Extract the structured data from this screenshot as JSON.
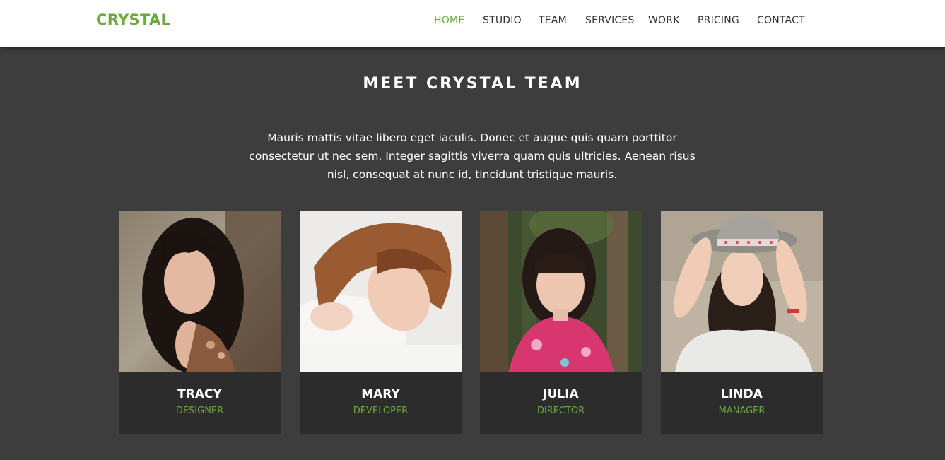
{
  "brand": {
    "name": "CRYSTAL"
  },
  "nav": {
    "items": [
      {
        "label": "HOME",
        "active": true
      },
      {
        "label": "STUDIO",
        "active": false
      },
      {
        "label": "TEAM",
        "active": false
      },
      {
        "label": "SERVICES",
        "active": false
      },
      {
        "label": "WORK",
        "active": false
      },
      {
        "label": "PRICING",
        "active": false
      },
      {
        "label": "CONTACT",
        "active": false
      }
    ]
  },
  "team": {
    "title": "MEET CRYSTAL TEAM",
    "description": "Mauris mattis vitae libero eget iaculis. Donec et augue quis quam porttitor consectetur ut nec sem. Integer sagittis viverra quam quis ultricies. Aenean risus nisl, consequat at nunc id, tincidunt tristique mauris.",
    "members": [
      {
        "name": "TRACY",
        "role": "DESIGNER"
      },
      {
        "name": "MARY",
        "role": "DEVELOPER"
      },
      {
        "name": "JULIA",
        "role": "DIRECTOR"
      },
      {
        "name": "LINDA",
        "role": "MANAGER"
      }
    ]
  },
  "colors": {
    "accent": "#6aaa3a",
    "background": "#3d3d3d",
    "card": "#2c2c2c",
    "navbar": "#ffffff"
  }
}
